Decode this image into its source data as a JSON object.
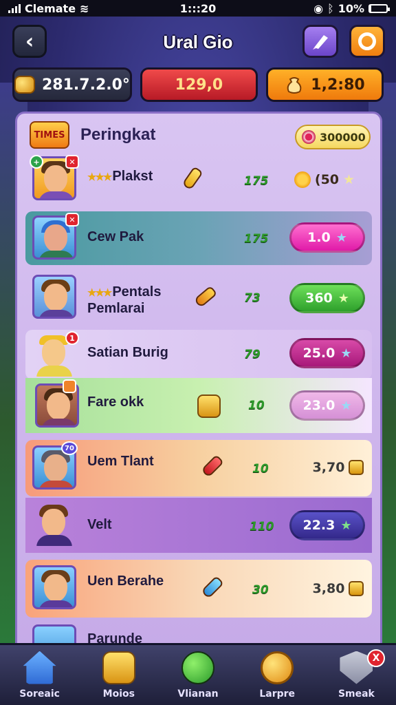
{
  "status_bar": {
    "carrier": "Clemate",
    "time": "1:::20",
    "battery": "10%",
    "battery_level": 0.1
  },
  "header": {
    "title": "Ural Gio"
  },
  "resources": [
    {
      "value": "281.7.2.0°"
    },
    {
      "value": "129,0"
    },
    {
      "value": "1,2:80"
    }
  ],
  "panel": {
    "title": "Peringkat",
    "badge_text": "TIMES",
    "score": "300000"
  },
  "rows": [
    {
      "name": "Plakst",
      "name2": "",
      "stars": "★★★",
      "level": "175",
      "reward": "(50",
      "badge": "+",
      "item_color": "#f0c028"
    },
    {
      "name": "Cew Pak",
      "name2": "",
      "stars": "",
      "level": "175",
      "reward": "1.0",
      "badge": "✕",
      "item_color": ""
    },
    {
      "name": "Pentals",
      "name2": "Pemlarai",
      "stars": "★★★",
      "level": "73",
      "reward": "360",
      "badge": "",
      "item_color": "#f0c028"
    },
    {
      "name": "Satian Burig",
      "name2": "",
      "stars": "",
      "level": "79",
      "reward": "25.0",
      "badge": "1",
      "item_color": ""
    },
    {
      "name": "Fare okk",
      "name2": "",
      "stars": "",
      "level": "10",
      "reward": "23.0",
      "badge": "",
      "item_color": "#f0c028"
    },
    {
      "name": "Uem Tlant",
      "name2": "",
      "stars": "",
      "level": "10",
      "reward": "3,70",
      "badge": "70",
      "item_color": "#e0343a"
    },
    {
      "name": "Velt",
      "name2": "",
      "stars": "",
      "level": "110",
      "reward": "22.3",
      "badge": "",
      "item_color": ""
    },
    {
      "name": "Uen Berahe",
      "name2": "",
      "stars": "",
      "level": "30",
      "reward": "3,80",
      "badge": "",
      "item_color": "#4aa8e8"
    },
    {
      "name": "Parunde",
      "name2": "",
      "stars": "",
      "level": "",
      "reward": "",
      "badge": "",
      "item_color": ""
    }
  ],
  "nav": [
    {
      "label": "Soreaic",
      "icon": "home-icon"
    },
    {
      "label": "Moios",
      "icon": "chest-icon"
    },
    {
      "label": "Vlianan",
      "icon": "football-icon"
    },
    {
      "label": "Larpre",
      "icon": "coin-icon"
    },
    {
      "label": "Smeak",
      "icon": "shield-icon",
      "notif": "X"
    }
  ]
}
